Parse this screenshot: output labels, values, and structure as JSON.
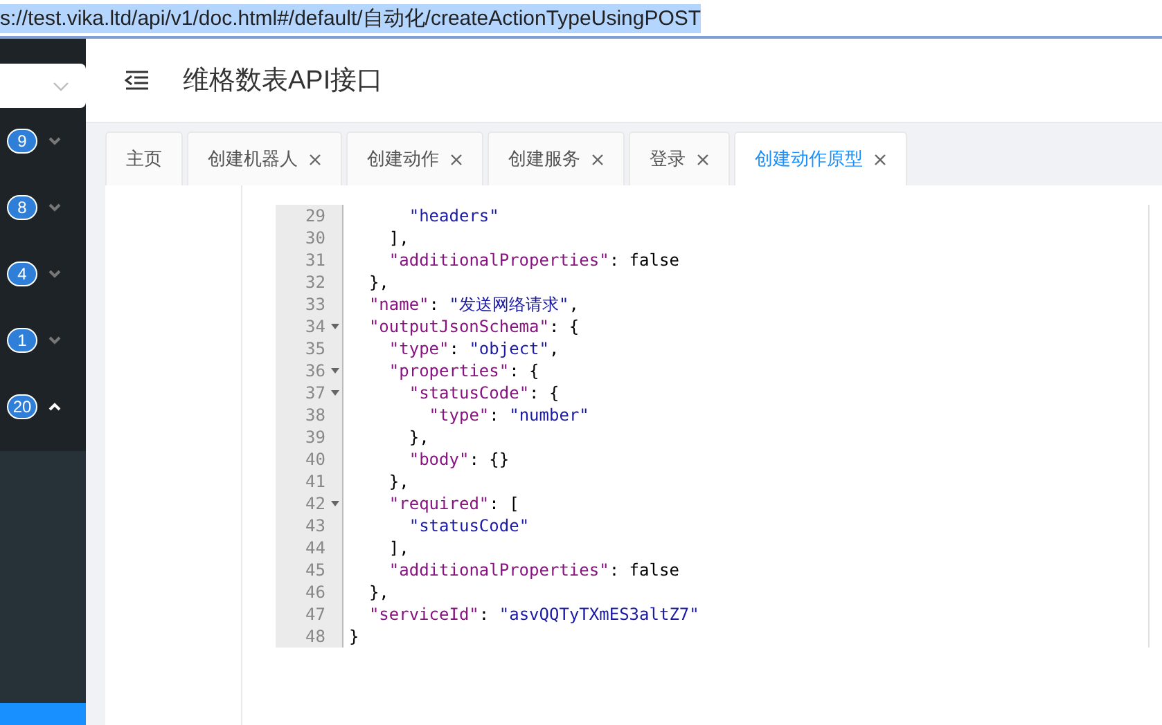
{
  "address_bar": {
    "url": "s://test.vika.ltd/api/v1/doc.html#/default/自动化/createActionTypeUsingPOST",
    "selected": true
  },
  "sidebar": {
    "items": [
      {
        "badge": "9",
        "expanded": false
      },
      {
        "badge": "8",
        "expanded": false
      },
      {
        "badge": "4",
        "expanded": false
      },
      {
        "badge": "1",
        "expanded": false
      },
      {
        "badge": "20",
        "expanded": true
      }
    ]
  },
  "header": {
    "title": "维格数表API接口"
  },
  "tabs": [
    {
      "label": "主页",
      "closable": false,
      "selected": false
    },
    {
      "label": "创建机器人",
      "closable": true,
      "selected": false
    },
    {
      "label": "创建动作",
      "closable": true,
      "selected": false
    },
    {
      "label": "创建服务",
      "closable": true,
      "selected": false
    },
    {
      "label": "登录",
      "closable": true,
      "selected": false
    },
    {
      "label": "创建动作原型",
      "closable": true,
      "selected": true
    }
  ],
  "code_lines": [
    {
      "children": [
        {
          "children": [
            {
              "children": [
                {
                  "number": "29",
                  "foldable": false,
                  "tokens": [
                    {
                      "kind": "string",
                      "text": "\"headers\""
                    }
                  ]
                }
              ]
            },
            {
              "number": "30",
              "foldable": false,
              "tokens": [
                {
                  "kind": "punct",
                  "text": "],"
                }
              ]
            },
            {
              "number": "31",
              "foldable": false,
              "tokens": [
                {
                  "kind": "key",
                  "text": "\"additionalProperties\""
                },
                {
                  "kind": "punct",
                  "text": ": false"
                }
              ]
            }
          ]
        },
        {
          "number": "32",
          "foldable": false,
          "tokens": [
            {
              "kind": "punct",
              "text": "},"
            }
          ]
        },
        {
          "number": "33",
          "foldable": false,
          "tokens": [
            {
              "kind": "key",
              "text": "\"name\""
            },
            {
              "kind": "punct",
              "text": ": "
            },
            {
              "kind": "string",
              "text": "\"发送网络请求\""
            },
            {
              "kind": "punct",
              "text": ","
            }
          ]
        },
        {
          "number": "34",
          "foldable": true,
          "tokens": [
            {
              "kind": "key",
              "text": "\"outputJsonSchema\""
            },
            {
              "kind": "punct",
              "text": ": {"
            }
          ],
          "children": [
            {
              "number": "35",
              "foldable": false,
              "tokens": [
                {
                  "kind": "key",
                  "text": "\"type\""
                },
                {
                  "kind": "punct",
                  "text": ": "
                },
                {
                  "kind": "string",
                  "text": "\"object\""
                },
                {
                  "kind": "punct",
                  "text": ","
                }
              ]
            },
            {
              "number": "36",
              "foldable": true,
              "tokens": [
                {
                  "kind": "key",
                  "text": "\"properties\""
                },
                {
                  "kind": "punct",
                  "text": ": {"
                }
              ],
              "children": [
                {
                  "number": "37",
                  "foldable": true,
                  "tokens": [
                    {
                      "kind": "key",
                      "text": "\"statusCode\""
                    },
                    {
                      "kind": "punct",
                      "text": ": {"
                    }
                  ],
                  "children": [
                    {
                      "number": "38",
                      "foldable": false,
                      "tokens": [
                        {
                          "kind": "key",
                          "text": "\"type\""
                        },
                        {
                          "kind": "punct",
                          "text": ": "
                        },
                        {
                          "kind": "string",
                          "text": "\"number\""
                        }
                      ]
                    }
                  ]
                },
                {
                  "number": "39",
                  "foldable": false,
                  "tokens": [
                    {
                      "kind": "punct",
                      "text": "},"
                    }
                  ]
                },
                {
                  "number": "40",
                  "foldable": false,
                  "tokens": [
                    {
                      "kind": "key",
                      "text": "\"body\""
                    },
                    {
                      "kind": "punct",
                      "text": ": {}"
                    }
                  ]
                }
              ]
            },
            {
              "number": "41",
              "foldable": false,
              "tokens": [
                {
                  "kind": "punct",
                  "text": "},"
                }
              ]
            },
            {
              "number": "42",
              "foldable": true,
              "tokens": [
                {
                  "kind": "key",
                  "text": "\"required\""
                },
                {
                  "kind": "punct",
                  "text": ": ["
                }
              ],
              "children": [
                {
                  "number": "43",
                  "foldable": false,
                  "tokens": [
                    {
                      "kind": "string",
                      "text": "\"statusCode\""
                    }
                  ]
                }
              ]
            },
            {
              "number": "44",
              "foldable": false,
              "tokens": [
                {
                  "kind": "punct",
                  "text": "],"
                }
              ]
            },
            {
              "number": "45",
              "foldable": false,
              "tokens": [
                {
                  "kind": "key",
                  "text": "\"additionalProperties\""
                },
                {
                  "kind": "punct",
                  "text": ": false"
                }
              ]
            }
          ]
        },
        {
          "number": "46",
          "foldable": false,
          "tokens": [
            {
              "kind": "punct",
              "text": "},"
            }
          ]
        },
        {
          "number": "47",
          "foldable": false,
          "tokens": [
            {
              "kind": "key",
              "text": "\"serviceId\""
            },
            {
              "kind": "punct",
              "text": ": "
            },
            {
              "kind": "string",
              "text": "\"asvQQTyTXmES3altZ7\""
            }
          ]
        }
      ]
    },
    {
      "number": "48",
      "foldable": false,
      "tokens": [
        {
          "kind": "punct",
          "text": "}"
        }
      ]
    }
  ]
}
